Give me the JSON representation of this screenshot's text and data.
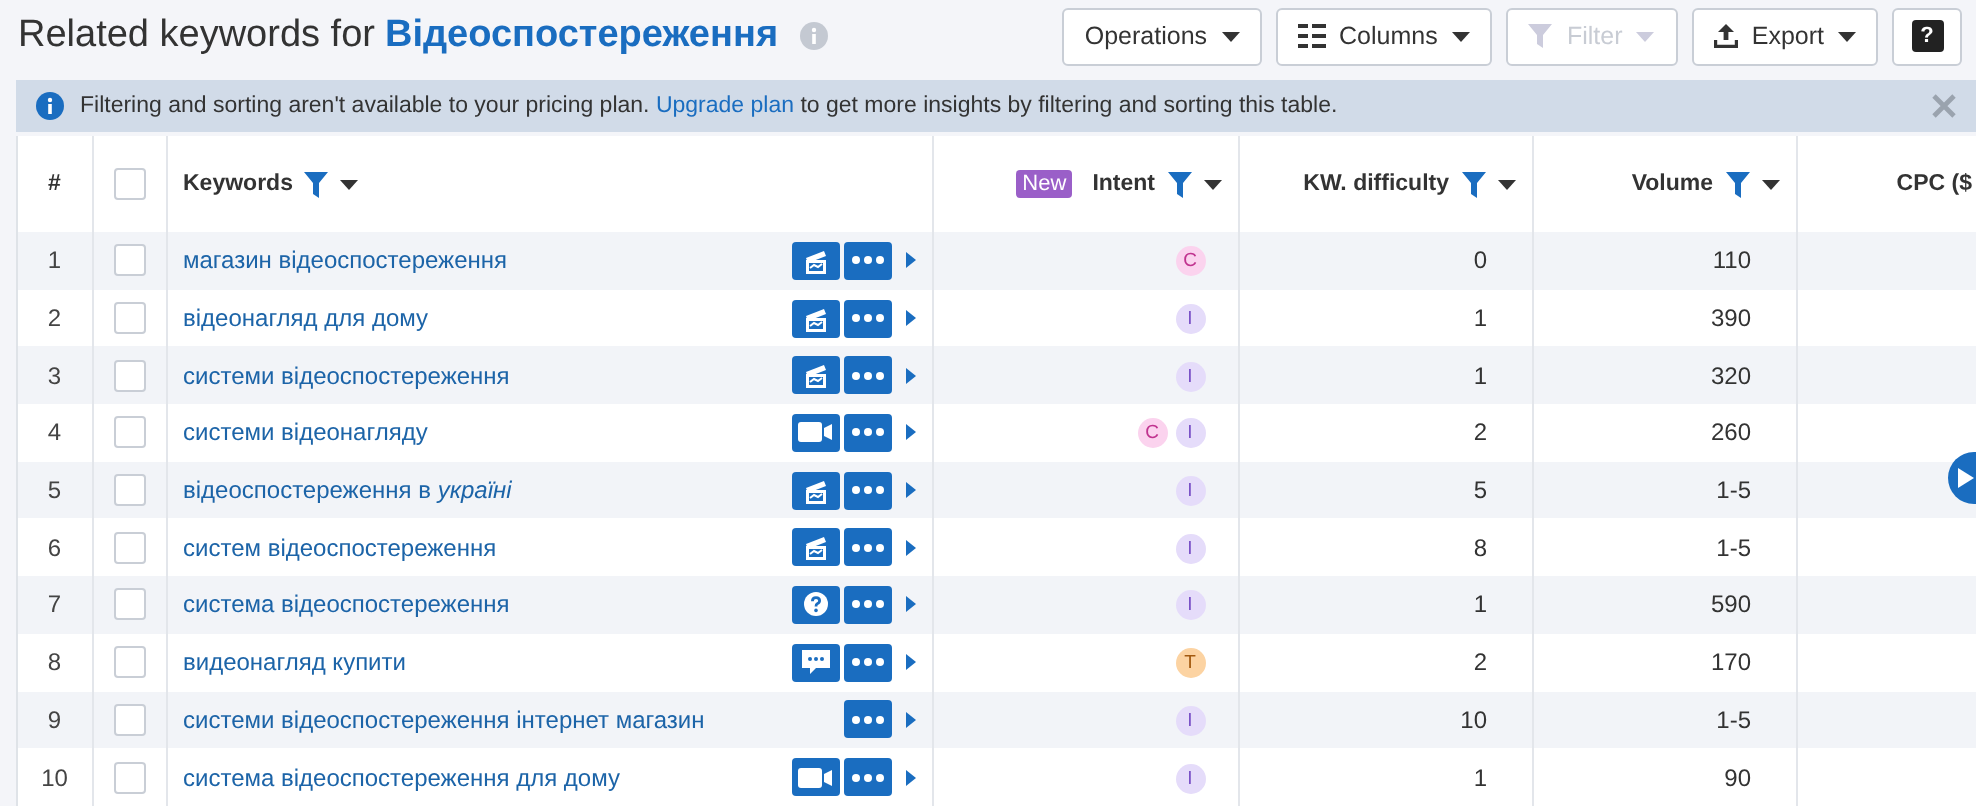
{
  "title": {
    "prefix": "Related keywords for",
    "query": "Відеоспостереження"
  },
  "toolbar": [
    {
      "label": "Operations",
      "kind": "menu",
      "disabled": false
    },
    {
      "label": "Columns",
      "kind": "columns",
      "disabled": false
    },
    {
      "label": "Filter",
      "kind": "filter",
      "disabled": true
    },
    {
      "label": "Export",
      "kind": "export",
      "disabled": false
    },
    {
      "label": "?",
      "kind": "help"
    }
  ],
  "banner": {
    "before": "Filtering and sorting aren't available to your pricing plan.",
    "link": "Upgrade plan",
    "after": "to get more insights by filtering and sorting this table."
  },
  "table": {
    "columns": [
      {
        "label": "#",
        "kind": "index"
      },
      {
        "kind": "check",
        "checked": false
      },
      {
        "label": "Keywords",
        "kind": "keyword"
      },
      {
        "label": "Intent",
        "kind": "intent",
        "badge": "New"
      },
      {
        "label": "KW. difficulty",
        "kind": "num"
      },
      {
        "label": "Volume",
        "kind": "num"
      },
      {
        "label": "CPC ($",
        "kind": "cut"
      }
    ],
    "rows": [
      {
        "index": "1",
        "checked": false,
        "keyword": "магазин відеоспостереження",
        "feature": {
          "kind": "sitelinks"
        },
        "intents": [
          {
            "label": "C",
            "kind": "commercial"
          }
        ],
        "difficulty": "0",
        "volume": "110"
      },
      {
        "index": "2",
        "checked": false,
        "keyword": "відеонагляд для дому",
        "feature": {
          "kind": "sitelinks"
        },
        "intents": [
          {
            "label": "I",
            "kind": "informational"
          }
        ],
        "difficulty": "1",
        "volume": "390"
      },
      {
        "index": "3",
        "checked": false,
        "keyword": "системи відеоспостереження",
        "feature": {
          "kind": "sitelinks"
        },
        "intents": [
          {
            "label": "I",
            "kind": "informational"
          }
        ],
        "difficulty": "1",
        "volume": "320"
      },
      {
        "index": "4",
        "checked": false,
        "keyword": "системи відеонагляду",
        "feature": {
          "kind": "video"
        },
        "intents": [
          {
            "label": "C",
            "kind": "commercial"
          },
          {
            "label": "I",
            "kind": "informational"
          }
        ],
        "difficulty": "2",
        "volume": "260"
      },
      {
        "index": "5",
        "checked": false,
        "keyword": "відеоспостереження в *україні*",
        "feature": {
          "kind": "sitelinks"
        },
        "intents": [
          {
            "label": "I",
            "kind": "informational"
          }
        ],
        "difficulty": "5",
        "volume": "1-5"
      },
      {
        "index": "6",
        "checked": false,
        "keyword": "систем відеоспостереження",
        "feature": {
          "kind": "sitelinks"
        },
        "intents": [
          {
            "label": "I",
            "kind": "informational"
          }
        ],
        "difficulty": "8",
        "volume": "1-5"
      },
      {
        "index": "7",
        "checked": false,
        "keyword": "система відеоспостереження",
        "feature": {
          "kind": "faq"
        },
        "intents": [
          {
            "label": "I",
            "kind": "informational"
          }
        ],
        "difficulty": "1",
        "volume": "590"
      },
      {
        "index": "8",
        "checked": false,
        "keyword": "видеонагляд купити",
        "feature": {
          "kind": "reviews"
        },
        "intents": [
          {
            "label": "T",
            "kind": "transactional"
          }
        ],
        "difficulty": "2",
        "volume": "170"
      },
      {
        "index": "9",
        "checked": false,
        "keyword": "системи відеоспостереження інтернет магазин",
        "intents": [
          {
            "label": "I",
            "kind": "informational"
          }
        ],
        "difficulty": "10",
        "volume": "1-5"
      },
      {
        "index": "10",
        "checked": false,
        "keyword": "система відеоспостереження для дому",
        "feature": {
          "kind": "video"
        },
        "intents": [
          {
            "label": "I",
            "kind": "informational"
          }
        ],
        "difficulty": "1",
        "volume": "90"
      }
    ]
  }
}
